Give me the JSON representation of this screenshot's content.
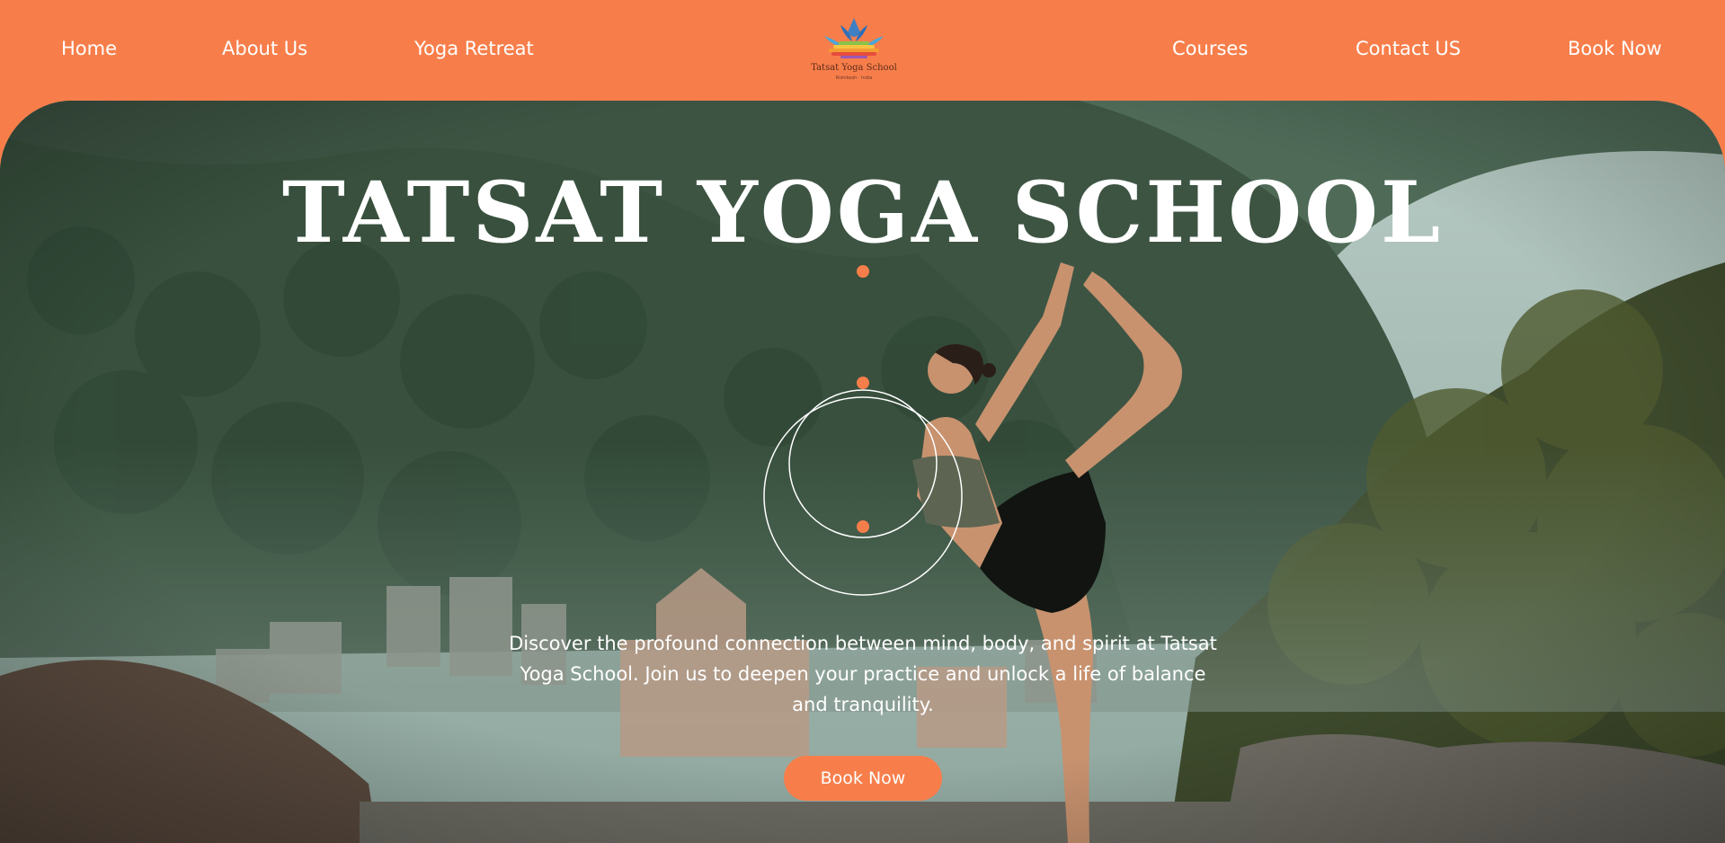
{
  "nav": {
    "left": [
      "Home",
      "About Us",
      "Yoga Retreat"
    ],
    "right": [
      "Courses",
      "Contact US",
      "Book Now"
    ]
  },
  "logo": {
    "text": "Tatsat Yoga School",
    "subtext": "Rishikesh · India",
    "icon": "lotus-icon"
  },
  "hero": {
    "title": "TATSAT YOGA SCHOOL",
    "description": "Discover the profound connection between mind, body, and spirit at Tatsat Yoga School. Join us to deepen your practice and unlock a life of balance and tranquility.",
    "cta_label": "Book Now",
    "image": "yoga-pose-by-river-photo"
  },
  "colors": {
    "accent": "#f77e4a",
    "text_light": "#ffffff"
  }
}
